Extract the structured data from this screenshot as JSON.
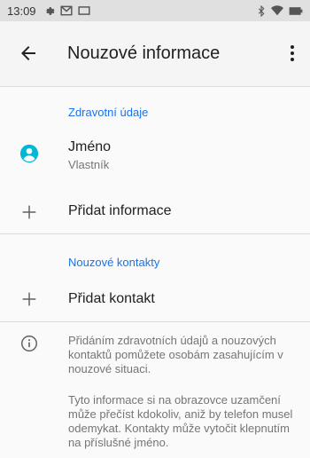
{
  "status": {
    "time": "13:09"
  },
  "appbar": {
    "title": "Nouzové informace"
  },
  "health": {
    "section_title": "Zdravotní údaje",
    "name": {
      "title": "Jméno",
      "subtitle": "Vlastník"
    },
    "add_info_label": "Přidat informace"
  },
  "contacts": {
    "section_title": "Nouzové kontakty",
    "add_contact_label": "Přidat kontakt"
  },
  "info": {
    "paragraph1": "Přidáním zdravotních údajů a nouzových kontaktů pomůžete osobám zasahujícím v nouzové situaci.",
    "paragraph2": "Tyto informace si na obrazovce uzamčení může přečíst kdokoliv, aniž by telefon musel odemykat. Kontakty může vytočit klepnutím na příslušné jméno."
  },
  "colors": {
    "accent": "#1a73e8",
    "avatar": "#00b8d4"
  },
  "icons": [
    "gear-icon",
    "mail-icon",
    "screen-icon",
    "bluetooth-icon",
    "wifi-icon",
    "battery-icon",
    "back-arrow-icon",
    "more-vert-icon",
    "account-icon",
    "plus-icon",
    "info-icon"
  ]
}
